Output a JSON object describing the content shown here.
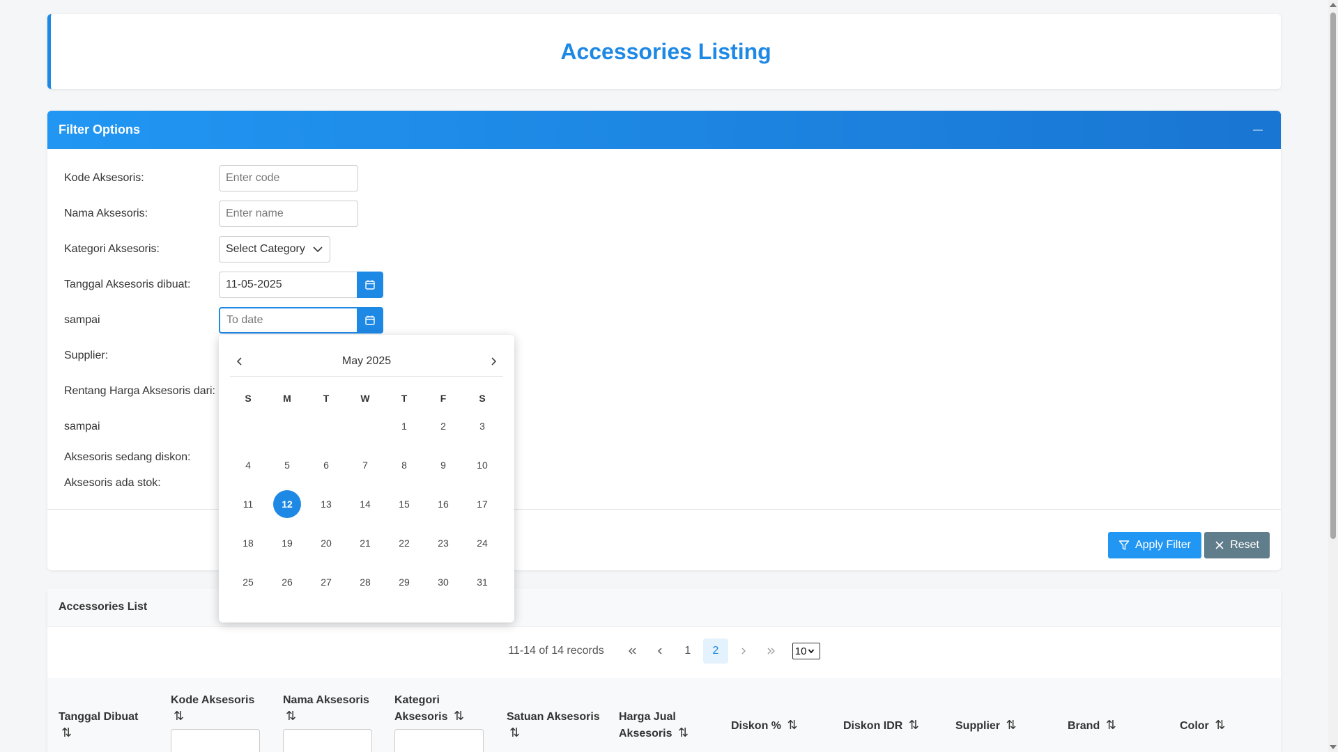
{
  "page": {
    "title": "Accessories Listing"
  },
  "filter": {
    "header": "Filter Options",
    "fields": {
      "code_label": "Kode Aksesoris:",
      "code_placeholder": "Enter code",
      "name_label": "Nama Aksesoris:",
      "name_placeholder": "Enter name",
      "category_label": "Kategori Aksesoris:",
      "category_value": "Select Category",
      "date_from_label": "Tanggal Aksesoris dibuat:",
      "date_from_value": "11-05-2025",
      "date_to_label": "sampai",
      "date_to_placeholder": "To date",
      "supplier_label": "Supplier:",
      "price_from_label": "Rentang Harga Aksesoris dari:",
      "price_to_label": "sampai",
      "discount_label": "Aksesoris sedang diskon:",
      "stock_label": "Aksesoris ada stok:"
    },
    "apply_label": "Apply Filter",
    "reset_label": "Reset"
  },
  "calendar": {
    "month_label": "May 2025",
    "weekdays": [
      "S",
      "M",
      "T",
      "W",
      "T",
      "F",
      "S"
    ],
    "weeks": [
      [
        "",
        "",
        "",
        "",
        "1",
        "2",
        "3"
      ],
      [
        "4",
        "5",
        "6",
        "7",
        "8",
        "9",
        "10"
      ],
      [
        "11",
        "12",
        "13",
        "14",
        "15",
        "16",
        "17"
      ],
      [
        "18",
        "19",
        "20",
        "21",
        "22",
        "23",
        "24"
      ],
      [
        "25",
        "26",
        "27",
        "28",
        "29",
        "30",
        "31"
      ]
    ],
    "selected_day": "12"
  },
  "list": {
    "header": "Accessories List",
    "pagination": {
      "info": "11-14 of 14 records",
      "pages": [
        "1",
        "2"
      ],
      "current_page": "2",
      "rows_per_page": "10"
    },
    "columns": [
      {
        "line1": "Tanggal Dibuat",
        "line2": "",
        "has_input": false
      },
      {
        "line1": "Kode Aksesoris",
        "line2": "",
        "has_input": true
      },
      {
        "line1": "Nama Aksesoris",
        "line2": "",
        "has_input": true
      },
      {
        "line1": "Kategori",
        "line2": "Aksesoris",
        "has_input": true
      },
      {
        "line1": "Satuan Aksesoris",
        "line2": "",
        "has_input": false
      },
      {
        "line1": "Harga Jual",
        "line2": "Aksesoris",
        "has_input": false
      },
      {
        "line1": "Diskon %",
        "line2": "",
        "has_input": false
      },
      {
        "line1": "Diskon IDR",
        "line2": "",
        "has_input": false
      },
      {
        "line1": "Supplier",
        "line2": "",
        "has_input": false
      },
      {
        "line1": "Brand",
        "line2": "",
        "has_input": false
      },
      {
        "line1": "Color",
        "line2": "",
        "has_input": false
      }
    ],
    "sort_icon": "⇅"
  },
  "colors": {
    "primary": "#1e88e5",
    "reset": "#607d8b"
  }
}
